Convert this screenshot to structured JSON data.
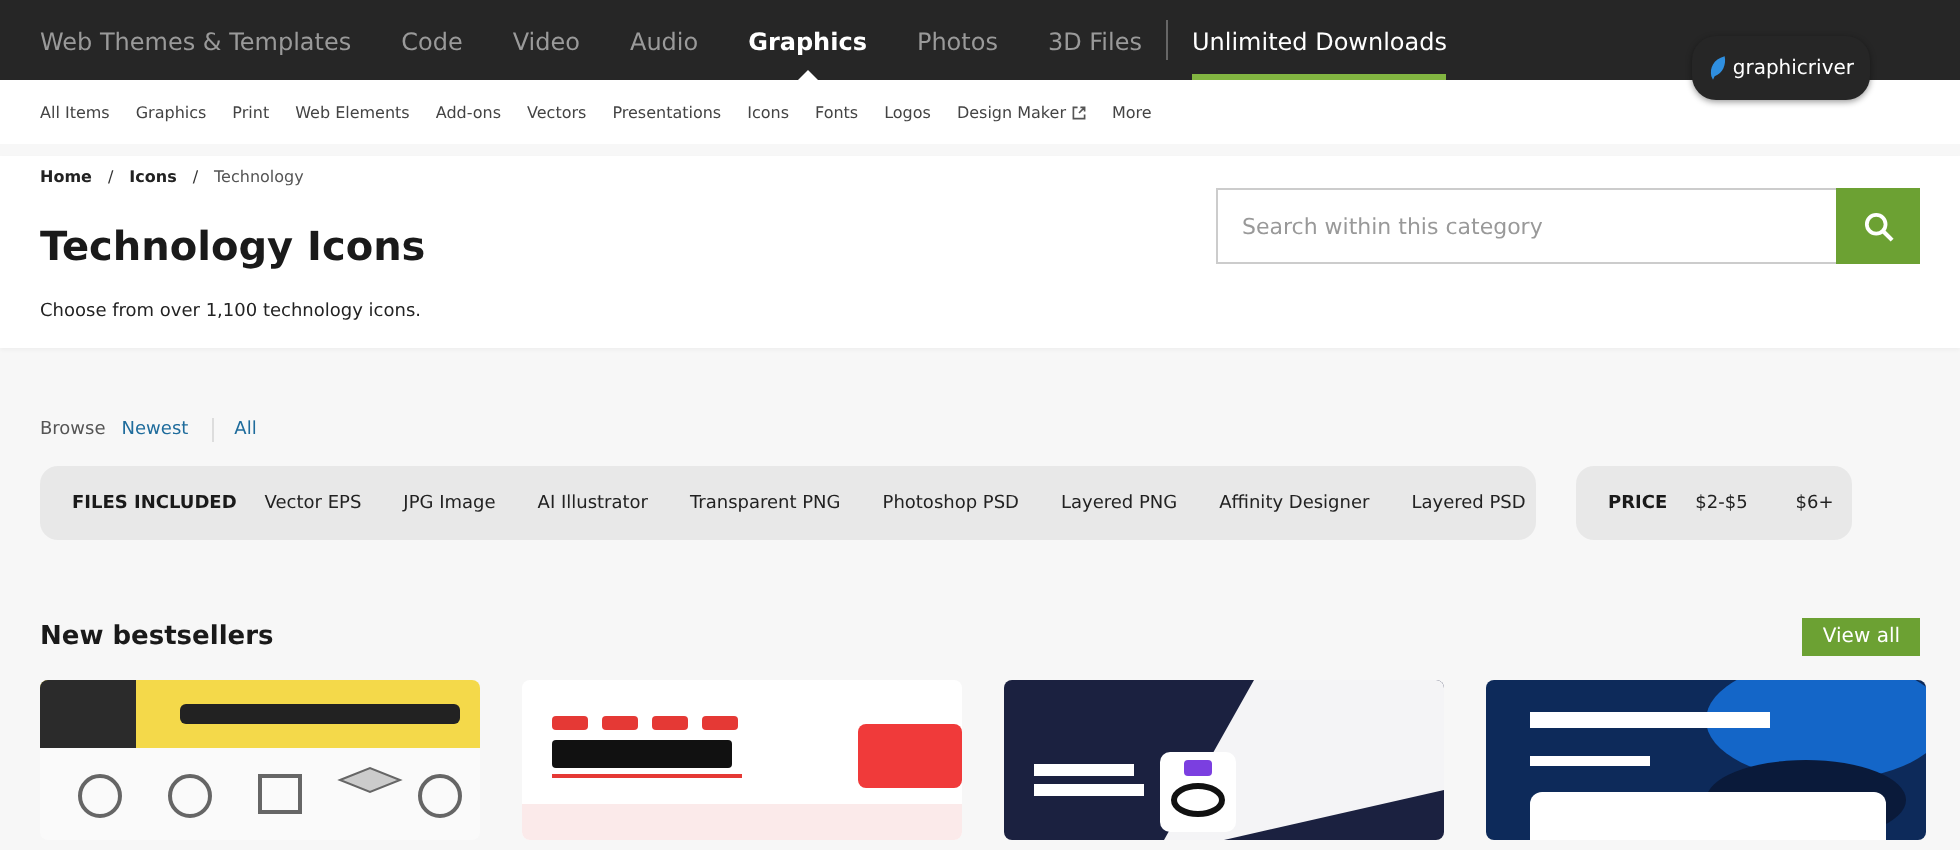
{
  "top_nav": [
    {
      "label": "Web Themes & Templates",
      "selected": false,
      "kind": "link"
    },
    {
      "label": "Code",
      "selected": false,
      "kind": "link"
    },
    {
      "label": "Video",
      "selected": false,
      "kind": "link"
    },
    {
      "label": "Audio",
      "selected": false,
      "kind": "link"
    },
    {
      "label": "Graphics",
      "selected": true,
      "kind": "link"
    },
    {
      "label": "Photos",
      "selected": false,
      "kind": "link"
    },
    {
      "label": "3D Files",
      "selected": false,
      "kind": "link"
    },
    {
      "label": "Unlimited Downloads",
      "selected": false,
      "kind": "promo"
    }
  ],
  "logo": {
    "text": "graphicriver"
  },
  "sub_nav": [
    {
      "label": "All Items",
      "external": false
    },
    {
      "label": "Graphics",
      "external": false
    },
    {
      "label": "Print",
      "external": false
    },
    {
      "label": "Web Elements",
      "external": false
    },
    {
      "label": "Add-ons",
      "external": false
    },
    {
      "label": "Vectors",
      "external": false
    },
    {
      "label": "Presentations",
      "external": false
    },
    {
      "label": "Icons",
      "external": false
    },
    {
      "label": "Fonts",
      "external": false
    },
    {
      "label": "Logos",
      "external": false
    },
    {
      "label": "Design Maker",
      "external": true
    },
    {
      "label": "More",
      "external": false
    }
  ],
  "breadcrumbs": [
    {
      "label": "Home",
      "current": false
    },
    {
      "label": "Icons",
      "current": false
    },
    {
      "label": "Technology",
      "current": true
    }
  ],
  "breadcrumb_separator": "/",
  "title": "Technology Icons",
  "subtitle": "Choose from over 1,100 technology icons.",
  "search": {
    "placeholder": "Search within this category"
  },
  "browse": {
    "label": "Browse",
    "options": [
      {
        "label": "Newest"
      },
      {
        "label": "All"
      }
    ]
  },
  "files_filter": {
    "label": "FILES INCLUDED",
    "options": [
      "Vector EPS",
      "JPG Image",
      "AI Illustrator",
      "Transparent PNG",
      "Photoshop PSD",
      "Layered PNG",
      "Affinity Designer",
      "Layered PSD"
    ]
  },
  "price_filter": {
    "label": "PRICE",
    "options": [
      "$2-$5",
      "$6+"
    ]
  },
  "section": {
    "title": "New bestsellers",
    "button": "View all"
  }
}
